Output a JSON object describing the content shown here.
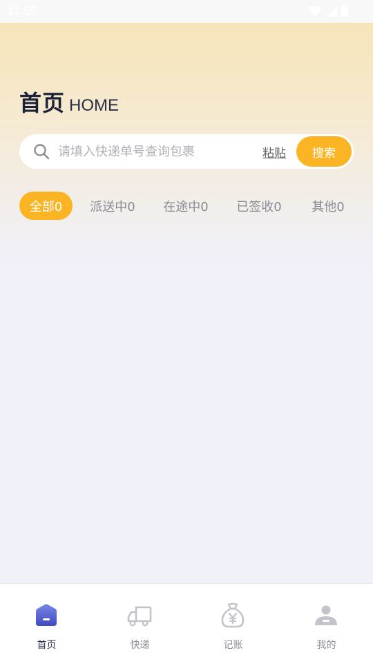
{
  "status_bar": {
    "time": "11:55"
  },
  "header": {
    "title_cn": "首页",
    "title_en": "HOME"
  },
  "search": {
    "placeholder": "请填入快递单号查询包裹",
    "value": "",
    "paste_label": "粘贴",
    "button_label": "搜索"
  },
  "tabs": [
    {
      "label": "全部0",
      "active": true
    },
    {
      "label": "派送中0",
      "active": false
    },
    {
      "label": "在途中0",
      "active": false
    },
    {
      "label": "已签收0",
      "active": false
    },
    {
      "label": "其他0",
      "active": false
    }
  ],
  "bottom_nav": [
    {
      "label": "首页",
      "icon": "home-icon",
      "active": true
    },
    {
      "label": "快递",
      "icon": "truck-icon",
      "active": false
    },
    {
      "label": "记账",
      "icon": "money-bag-icon",
      "active": false
    },
    {
      "label": "我的",
      "icon": "user-icon",
      "active": false
    }
  ],
  "colors": {
    "accent": "#fbb524",
    "nav_active": "#4d5ac8",
    "nav_inactive": "#c3c3cb",
    "text_dark": "#1b2136"
  }
}
